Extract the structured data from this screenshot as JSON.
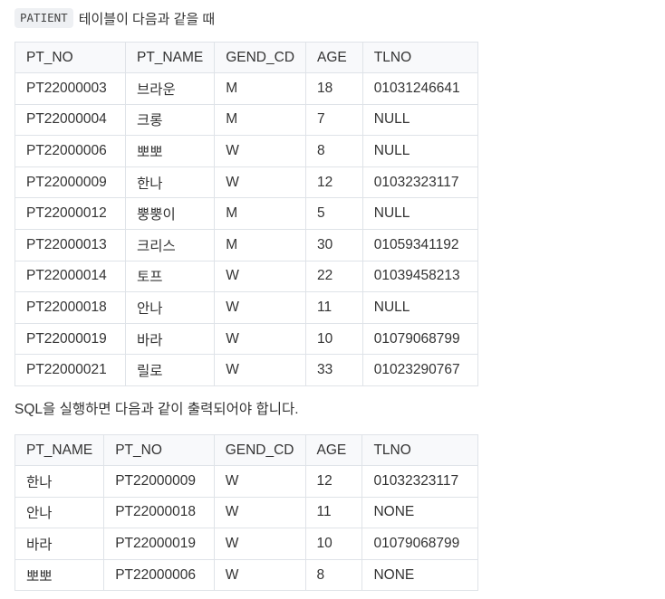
{
  "intro": {
    "code": "PATIENT",
    "text": "테이블이 다음과 같을 때"
  },
  "input_table": {
    "headers": [
      "PT_NO",
      "PT_NAME",
      "GEND_CD",
      "AGE",
      "TLNO"
    ],
    "rows": [
      [
        "PT22000003",
        "브라운",
        "M",
        "18",
        "01031246641"
      ],
      [
        "PT22000004",
        "크롱",
        "M",
        "7",
        "NULL"
      ],
      [
        "PT22000006",
        "뽀뽀",
        "W",
        "8",
        "NULL"
      ],
      [
        "PT22000009",
        "한나",
        "W",
        "12",
        "01032323117"
      ],
      [
        "PT22000012",
        "뿡뿡이",
        "M",
        "5",
        "NULL"
      ],
      [
        "PT22000013",
        "크리스",
        "M",
        "30",
        "01059341192"
      ],
      [
        "PT22000014",
        "토프",
        "W",
        "22",
        "01039458213"
      ],
      [
        "PT22000018",
        "안나",
        "W",
        "11",
        "NULL"
      ],
      [
        "PT22000019",
        "바라",
        "W",
        "10",
        "01079068799"
      ],
      [
        "PT22000021",
        "릴로",
        "W",
        "33",
        "01023290767"
      ]
    ]
  },
  "sentence": "SQL을 실행하면 다음과 같이 출력되어야 합니다.",
  "output_table": {
    "headers": [
      "PT_NAME",
      "PT_NO",
      "GEND_CD",
      "AGE",
      "TLNO"
    ],
    "rows": [
      [
        "한나",
        "PT22000009",
        "W",
        "12",
        "01032323117"
      ],
      [
        "안나",
        "PT22000018",
        "W",
        "11",
        "NONE"
      ],
      [
        "바라",
        "PT22000019",
        "W",
        "10",
        "01079068799"
      ],
      [
        "뽀뽀",
        "PT22000006",
        "W",
        "8",
        "NONE"
      ]
    ]
  }
}
